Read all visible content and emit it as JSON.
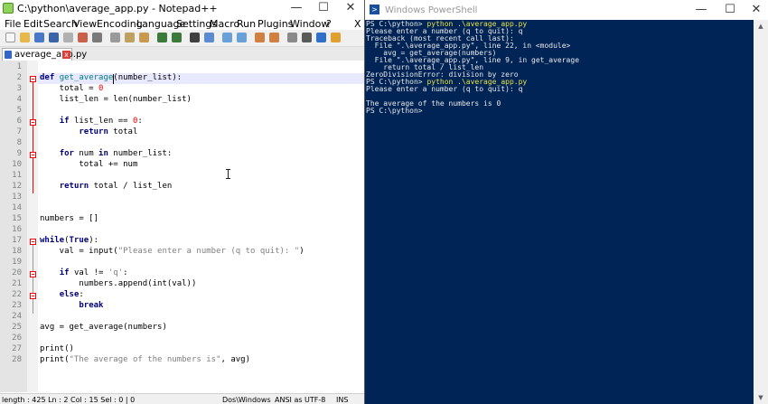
{
  "notepad": {
    "title": "C:\\python\\average_app.py - Notepad++",
    "window_controls": [
      "—",
      "☐",
      "✕"
    ],
    "menu": [
      "File",
      "Edit",
      "Search",
      "View",
      "Encoding",
      "Language",
      "Settings",
      "Macro",
      "Run",
      "Plugins",
      "Window",
      "?",
      "X"
    ],
    "tab_label": "average_app.py",
    "tab_close": "x",
    "line_numbers": [
      "1",
      "2",
      "3",
      "4",
      "5",
      "6",
      "7",
      "8",
      "9",
      "10",
      "11",
      "12",
      "13",
      "14",
      "15",
      "16",
      "17",
      "18",
      "19",
      "20",
      "21",
      "22",
      "23",
      "24",
      "25",
      "26",
      "27",
      "28"
    ],
    "code_lines": [
      "",
      "def get_average(number_list):",
      "    total = 0",
      "    list_len = len(number_list)",
      "",
      "    if list_len == 0:",
      "        return total",
      "",
      "    for num in number_list:",
      "        total += num",
      "",
      "    return total / list_len",
      "",
      "",
      "numbers = []",
      "",
      "while(True):",
      "    val = input(\"Please enter a number (q to quit): \")",
      "",
      "    if val != 'q':",
      "        numbers.append(int(val))",
      "    else:",
      "        break",
      "",
      "avg = get_average(numbers)",
      "",
      "print()",
      "print(\"The average of the numbers is\", avg)"
    ],
    "status": {
      "length": "length : 425   Ln : 2    Col : 15    Sel : 0 | 0",
      "eol": "Dos\\Windows",
      "encoding": "ANSI as UTF-8",
      "mode": "INS"
    }
  },
  "powershell": {
    "title": "Windows PowerShell",
    "window_controls": [
      "—",
      "☐",
      "✕"
    ],
    "lines": [
      {
        "prompt": "PS C:\\python> ",
        "cmd": "python .\\average_app.py"
      },
      {
        "text": "Please enter a number (q to quit): q"
      },
      {
        "text": "Traceback (most recent call last):"
      },
      {
        "text": "  File \".\\average_app.py\", line 22, in <module>"
      },
      {
        "text": "    avg = get_average(numbers)"
      },
      {
        "text": "  File \".\\average_app.py\", line 9, in get_average"
      },
      {
        "text": "    return total / list_len"
      },
      {
        "text": "ZeroDivisionError: division by zero"
      },
      {
        "prompt": "PS C:\\python> ",
        "cmd": "python .\\average_app.py"
      },
      {
        "text": "Please enter a number (q to quit): q"
      },
      {
        "text": ""
      },
      {
        "text": "The average of the numbers is 0"
      },
      {
        "text": "PS C:\\python>"
      }
    ]
  }
}
